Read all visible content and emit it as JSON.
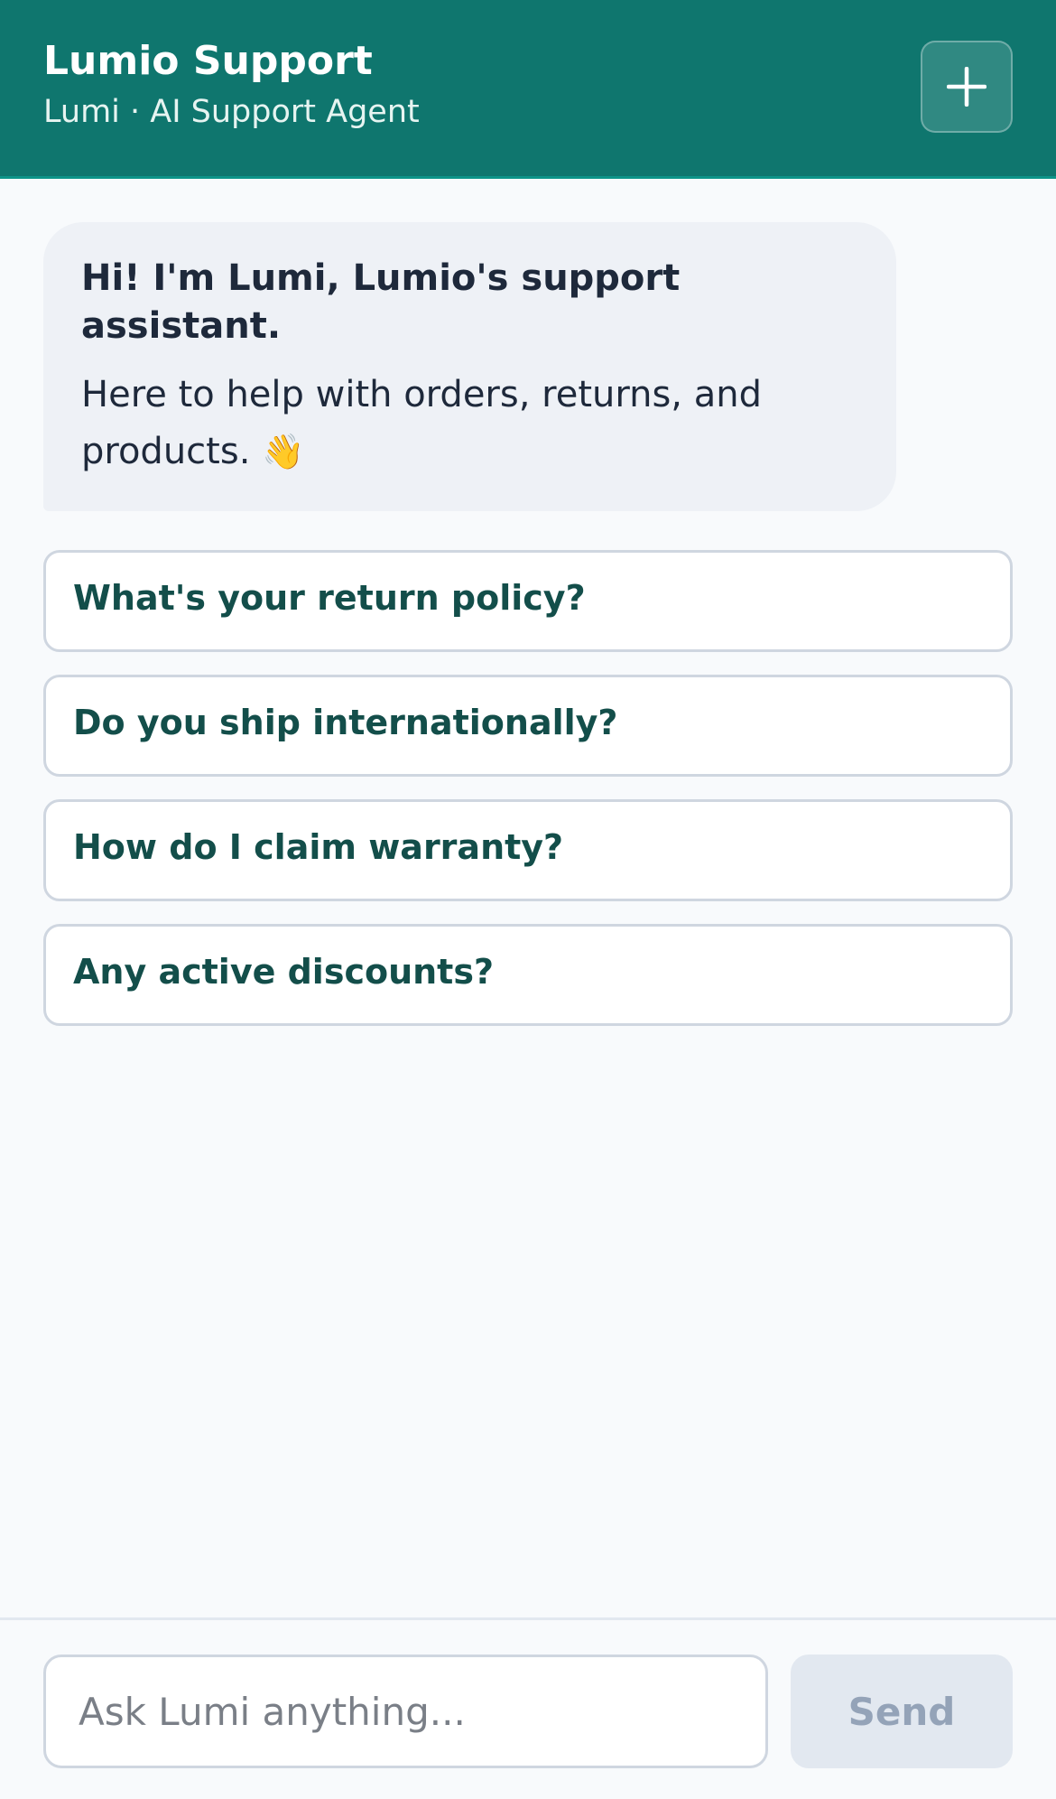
{
  "header": {
    "title": "Lumio Support",
    "subtitle": "Lumi · AI Support Agent",
    "new_chat_icon": "plus-icon"
  },
  "chat": {
    "messages": [
      {
        "role": "assistant",
        "greeting": "Hi! I'm Lumi, Lumio's support assistant.",
        "body": "Here to help with orders, returns, and products.",
        "emoji": "👋"
      }
    ],
    "suggestions": [
      "What's your return policy?",
      "Do you ship internationally?",
      "How do I claim warranty?",
      "Any active discounts?"
    ]
  },
  "composer": {
    "placeholder": "Ask Lumi anything...",
    "value": "",
    "send_label": "Send"
  },
  "colors": {
    "header_bg": "#0f766e",
    "bubble_bg": "#eef1f6",
    "suggestion_text": "#134e4a",
    "send_disabled_bg": "#e2e8f0",
    "send_disabled_text": "#94a3b8"
  }
}
